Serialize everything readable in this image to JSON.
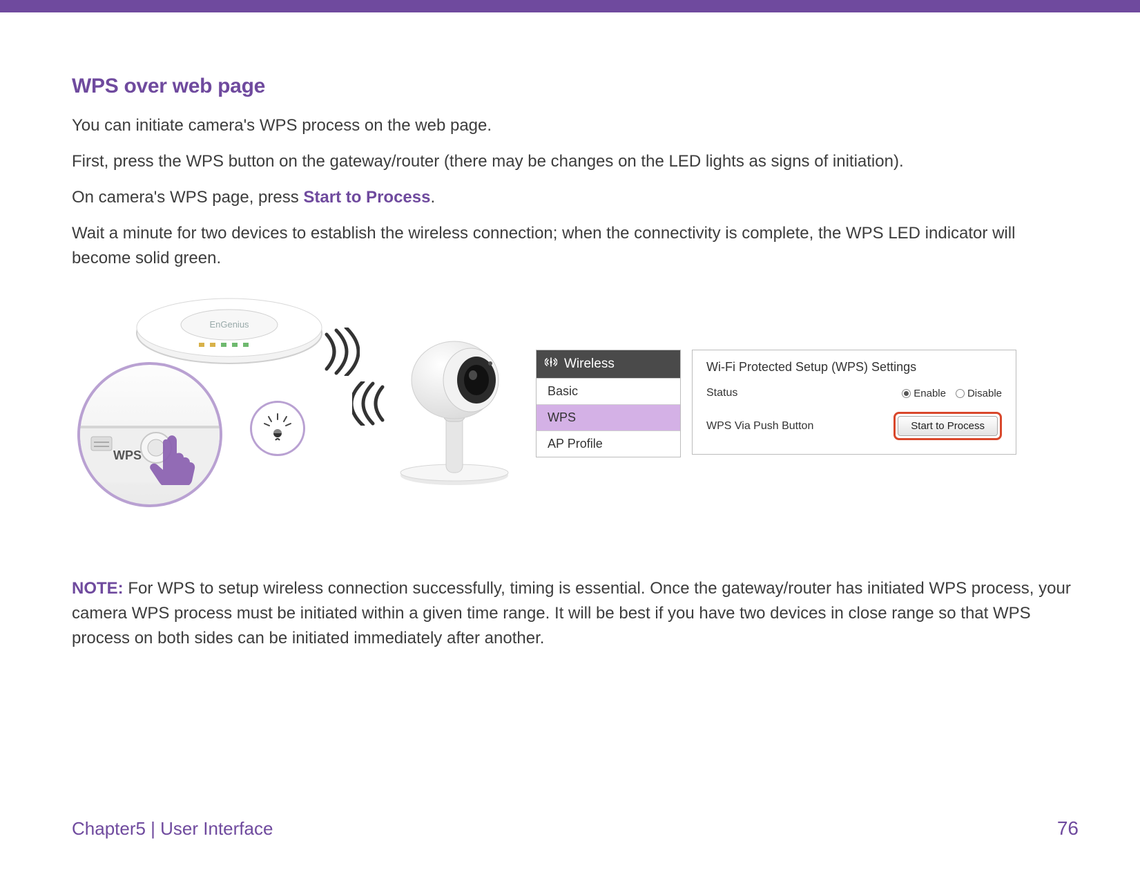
{
  "heading": "WPS over web page",
  "para1": "You can initiate camera's WPS process on the web page.",
  "para2": "First, press the WPS button on the gateway/router (there may be changes on the LED lights as signs of initiation).",
  "para3_pre": "On camera's WPS page, press ",
  "para3_strong": "Start to Process",
  "para3_post": ".",
  "para4": "Wait a minute for two devices to establish the wireless connection; when the connectivity is complete, the WPS LED indicator will become solid green.",
  "wps_button_label": "WPS",
  "nav": {
    "header": "Wireless",
    "items": [
      "Basic",
      "WPS",
      "AP Profile"
    ],
    "selected_index": 1
  },
  "settings": {
    "title": "Wi-Fi Protected Setup (WPS) Settings",
    "status_label": "Status",
    "enable_label": "Enable",
    "disable_label": "Disable",
    "status_value": "Enable",
    "push_label": "WPS Via Push Button",
    "button_label": "Start to Process"
  },
  "note": {
    "label": "NOTE:",
    "text": " For WPS to setup wireless connection successfully, timing is essential. Once the gateway/router has initiated WPS process, your camera WPS process must be initiated within a given time range. It will be best if you have two devices in close range so that WPS process on both sides can be initiated immediately after another."
  },
  "footer": {
    "chapter": "Chapter5  |  User Interface",
    "page": "76"
  }
}
